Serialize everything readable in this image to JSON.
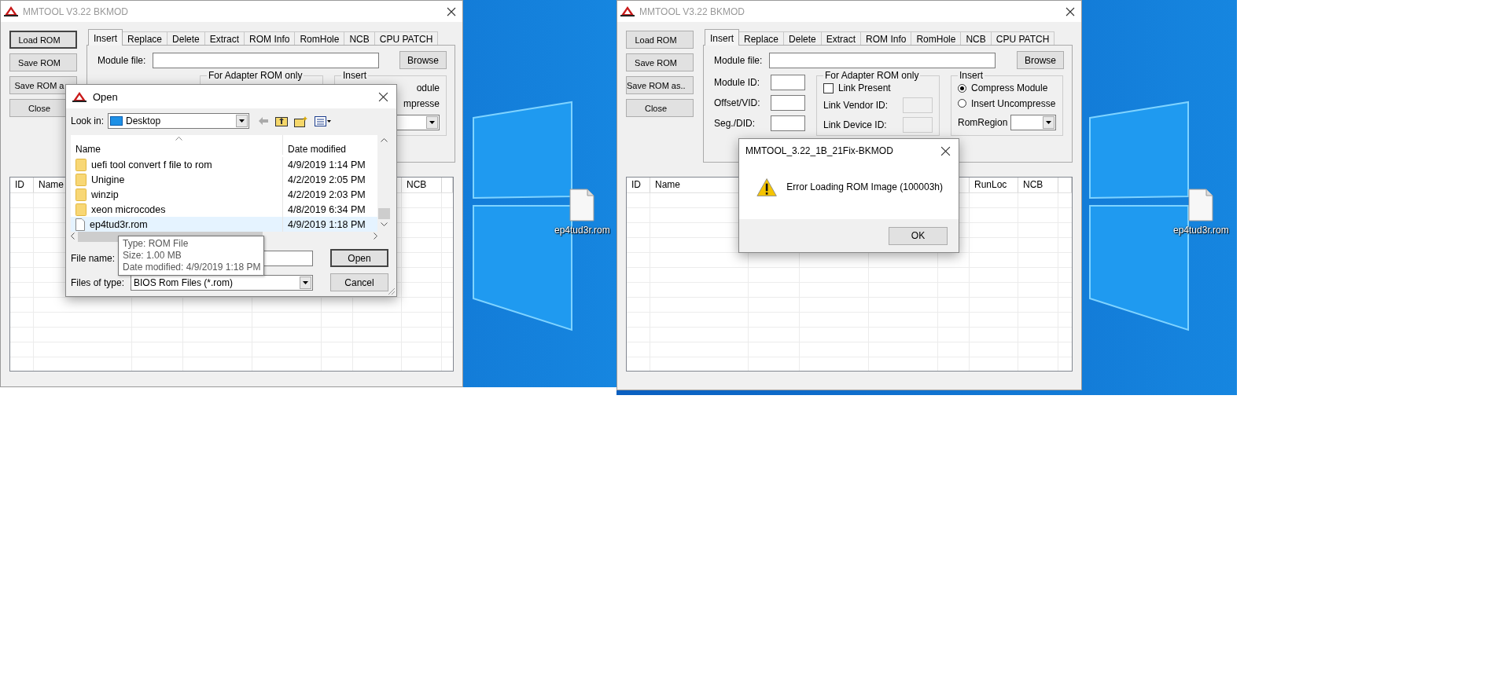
{
  "screenshots": [
    {
      "window": {
        "title": "MMTOOL V3.22 BKMOD",
        "buttons": [
          {
            "label": "Load ROM",
            "default": true
          },
          {
            "label": "Save ROM",
            "default": false
          },
          {
            "label": "Save ROM a",
            "default": false
          },
          {
            "label": "Close",
            "default": false
          }
        ],
        "tabs": [
          {
            "label": "Insert",
            "selected": true
          },
          {
            "label": "Replace",
            "selected": false
          },
          {
            "label": "Delete",
            "selected": false
          },
          {
            "label": "Extract",
            "selected": false
          },
          {
            "label": "ROM Info",
            "selected": false
          },
          {
            "label": "RomHole",
            "selected": false
          },
          {
            "label": "NCB",
            "selected": false
          },
          {
            "label": "CPU PATCH",
            "selected": false
          }
        ],
        "module_file_label": "Module file:",
        "browse_button": "Browse",
        "adapter_group": {
          "title": "For Adapter ROM only"
        },
        "insert_group": {
          "title": "Insert",
          "fragments": [
            "odule",
            "mpresse"
          ],
          "has_combo": true
        },
        "table": {
          "columns": [
            {
              "label": "ID"
            },
            {
              "label": "Name"
            },
            {},
            {},
            {},
            {},
            {},
            {
              "label": "NCB"
            }
          ]
        }
      },
      "desktop": {
        "file_label": "ep4tud3r.rom"
      },
      "open_dialog": {
        "title": "Open",
        "look_in_label": "Look in:",
        "look_in_value": "Desktop",
        "columns": [
          "Name",
          "Date modified"
        ],
        "files": [
          {
            "kind": "folder",
            "name": "uefi tool convert f file to rom",
            "date": "4/9/2019 1:14 PM",
            "selected": false
          },
          {
            "kind": "folder",
            "name": "Unigine",
            "date": "4/2/2019 2:05 PM",
            "selected": false
          },
          {
            "kind": "folder",
            "name": "winzip",
            "date": "4/2/2019 2:03 PM",
            "selected": false
          },
          {
            "kind": "folder",
            "name": "xeon microcodes",
            "date": "4/8/2019 6:34 PM",
            "selected": false
          },
          {
            "kind": "file",
            "name": "ep4tud3r.rom",
            "date": "4/9/2019 1:18 PM",
            "selected": true
          }
        ],
        "tooltip": [
          "Type: ROM File",
          "Size: 1.00 MB",
          "Date modified: 4/9/2019 1:18 PM"
        ],
        "file_name_label": "File name:",
        "files_of_type_label": "Files of type:",
        "files_of_type_value": "BIOS Rom Files (*.rom)",
        "buttons": [
          {
            "label": "Open",
            "default": true
          },
          {
            "label": "Cancel",
            "default": false
          }
        ]
      }
    },
    {
      "window": {
        "title": "MMTOOL V3.22 BKMOD",
        "buttons": [
          {
            "label": "Load ROM",
            "default": false
          },
          {
            "label": "Save ROM",
            "default": false
          },
          {
            "label": "Save ROM as..",
            "default": false
          },
          {
            "label": "Close",
            "default": false
          }
        ],
        "tabs": [
          {
            "label": "Insert",
            "selected": true
          },
          {
            "label": "Replace",
            "selected": false
          },
          {
            "label": "Delete",
            "selected": false
          },
          {
            "label": "Extract",
            "selected": false
          },
          {
            "label": "ROM Info",
            "selected": false
          },
          {
            "label": "RomHole",
            "selected": false
          },
          {
            "label": "NCB",
            "selected": false
          },
          {
            "label": "CPU PATCH",
            "selected": false
          }
        ],
        "module_file_label": "Module file:",
        "browse_button": "Browse",
        "fields": [
          {
            "label": "Module ID:"
          },
          {
            "label": "Offset/VID:"
          },
          {
            "label": "Seg./DID:"
          }
        ],
        "adapter_group": {
          "title": "For Adapter ROM only",
          "link_present": {
            "label": "Link Present",
            "checked": false
          },
          "fields": [
            {
              "label": "Link Vendor ID:",
              "disabled": true
            },
            {
              "label": "Link Device ID:",
              "disabled": true
            }
          ]
        },
        "insert_group": {
          "title": "Insert",
          "options": [
            {
              "label": "Compress Module",
              "selected": true
            },
            {
              "label": "Insert Uncompresse",
              "selected": false
            }
          ],
          "rom_region_label": "RomRegion",
          "has_combo": true
        },
        "table": {
          "columns": [
            {
              "label": "ID"
            },
            {
              "label": "Name"
            },
            {},
            {},
            {},
            {},
            {
              "label": "RunLoc"
            },
            {
              "label": "NCB"
            }
          ]
        }
      },
      "desktop": {
        "file_label": "ep4tud3r.rom"
      },
      "message_box": {
        "title": "MMTOOL_3.22_1B_21Fix-BKMOD",
        "message": "Error Loading ROM Image (100003h)",
        "button": "OK"
      }
    }
  ]
}
